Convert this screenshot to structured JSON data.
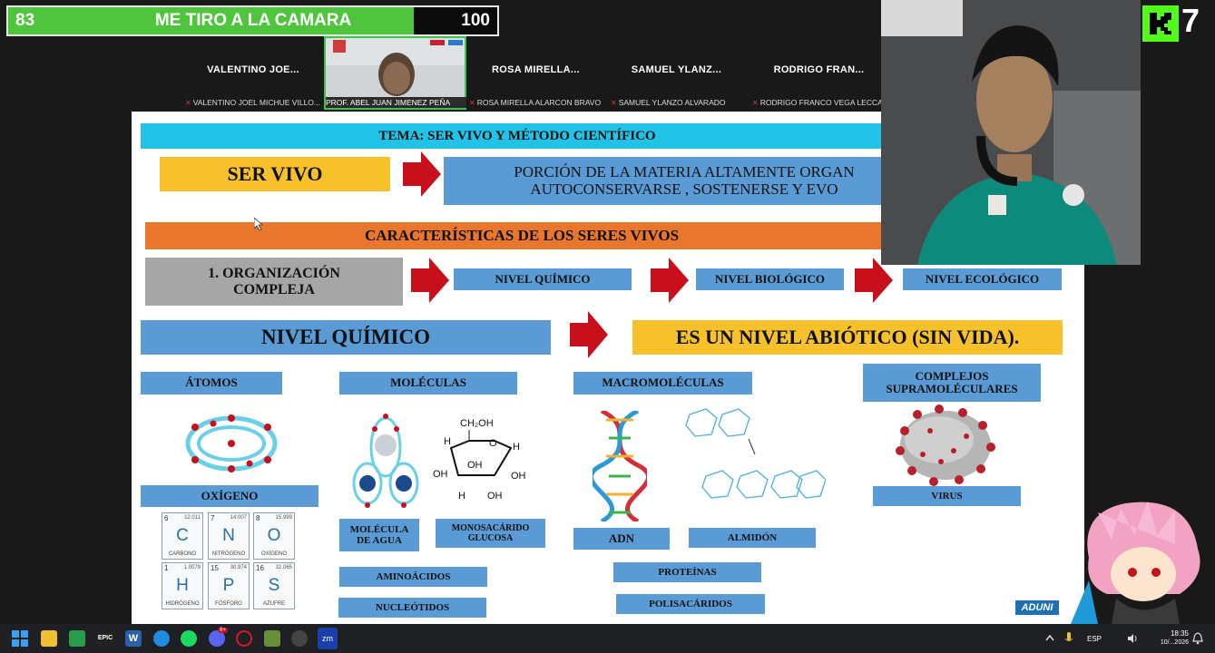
{
  "overlay": {
    "left_number": "83",
    "title": "ME TIRO A LA CAMARA",
    "right_number": "100",
    "progress": 0.83,
    "corner_badge": "7",
    "fill_color": "#4fc53e"
  },
  "participants": [
    {
      "short": "VALENTINO JOE...",
      "full": "VALENTINO JOEL MICHUE VILLO..."
    },
    {
      "short": "",
      "full": "PROF. ABEL JUAN JIMENEZ PEÑA"
    },
    {
      "short": "ROSA MIRELLA...",
      "full": "ROSA MIRELLA ALARCON BRAVO"
    },
    {
      "short": "SAMUEL YLANZ...",
      "full": "SAMUEL YLANZO ALVARADO"
    },
    {
      "short": "RODRIGO FRAN...",
      "full": "RODRIGO FRANCO VEGA LECCA"
    }
  ],
  "slide": {
    "tema": "TEMA: SER VIVO Y MÉTODO CIENTÍFICO",
    "ser_vivo": "SER VIVO",
    "definition_line1": "PORCIÓN DE LA MATERIA ALTAMENTE ORGAN",
    "definition_line2": "AUTOCONSERVARSE , SOSTENERSE Y EVO",
    "caracteristicas": "CARACTERÍSTICAS DE LOS SERES VIVOS",
    "organizacion_line1": "1. ORGANIZACIÓN",
    "organizacion_line2": "COMPLEJA",
    "nivel_quimico_small": "NIVEL QUÍMICO",
    "nivel_biologico": "NIVEL BIOLÓGICO",
    "nivel_ecologico": "NIVEL ECOLÓGICO",
    "nivel_quimico_big": "NIVEL QUÍMICO",
    "abiotico": "ES UN NIVEL ABIÓTICO (SIN VIDA).",
    "atomos": "ÁTOMOS",
    "moleculas": "MOLÉCULAS",
    "macromoleculas": "MACROMOLÉCULAS",
    "complejos_line1": "COMPLEJOS",
    "complejos_line2": "SUPRAMOLÉCULARES",
    "oxigeno": "OXÍGENO",
    "molecula_agua_line1": "MOLÉCULA",
    "molecula_agua_line2": "DE AGUA",
    "monosacarido_line1": "MONOSACÁRIDO",
    "monosacarido_line2": "GLUCOSA",
    "aminoacidos": "AMINOÁCIDOS",
    "nucleotidos": "NUCLEÓTIDOS",
    "adn": "ADN",
    "almidon": "ALMIDÓN",
    "proteinas": "PROTEÍNAS",
    "polisacaridos": "POLISACÁRIDOS",
    "virus": "VIRUS",
    "glucose_label": "CH₂OH",
    "glucose_oh": "OH",
    "glucose_h": "H",
    "glucose_o": "O",
    "logo": "ADUNI",
    "elements": [
      {
        "number": "6",
        "mass": "12.011",
        "symbol": "C",
        "name": "CARBONO"
      },
      {
        "number": "7",
        "mass": "14.007",
        "symbol": "N",
        "name": "NITRÓGENO"
      },
      {
        "number": "8",
        "mass": "15.999",
        "symbol": "O",
        "name": "OXÍGENO"
      },
      {
        "number": "1",
        "mass": "1.0079",
        "symbol": "H",
        "name": "HIDRÓGENO"
      },
      {
        "number": "15",
        "mass": "30.974",
        "symbol": "P",
        "name": "FÓSFORO"
      },
      {
        "number": "16",
        "mass": "32.065",
        "symbol": "S",
        "name": "AZUFRE"
      }
    ]
  },
  "taskbar": {
    "language": "ESP",
    "time": "18:35",
    "date": "10/...2026",
    "badge_count": "9+",
    "word_label": "W",
    "zoom_label": "zm",
    "epic_label": "EPIC"
  }
}
